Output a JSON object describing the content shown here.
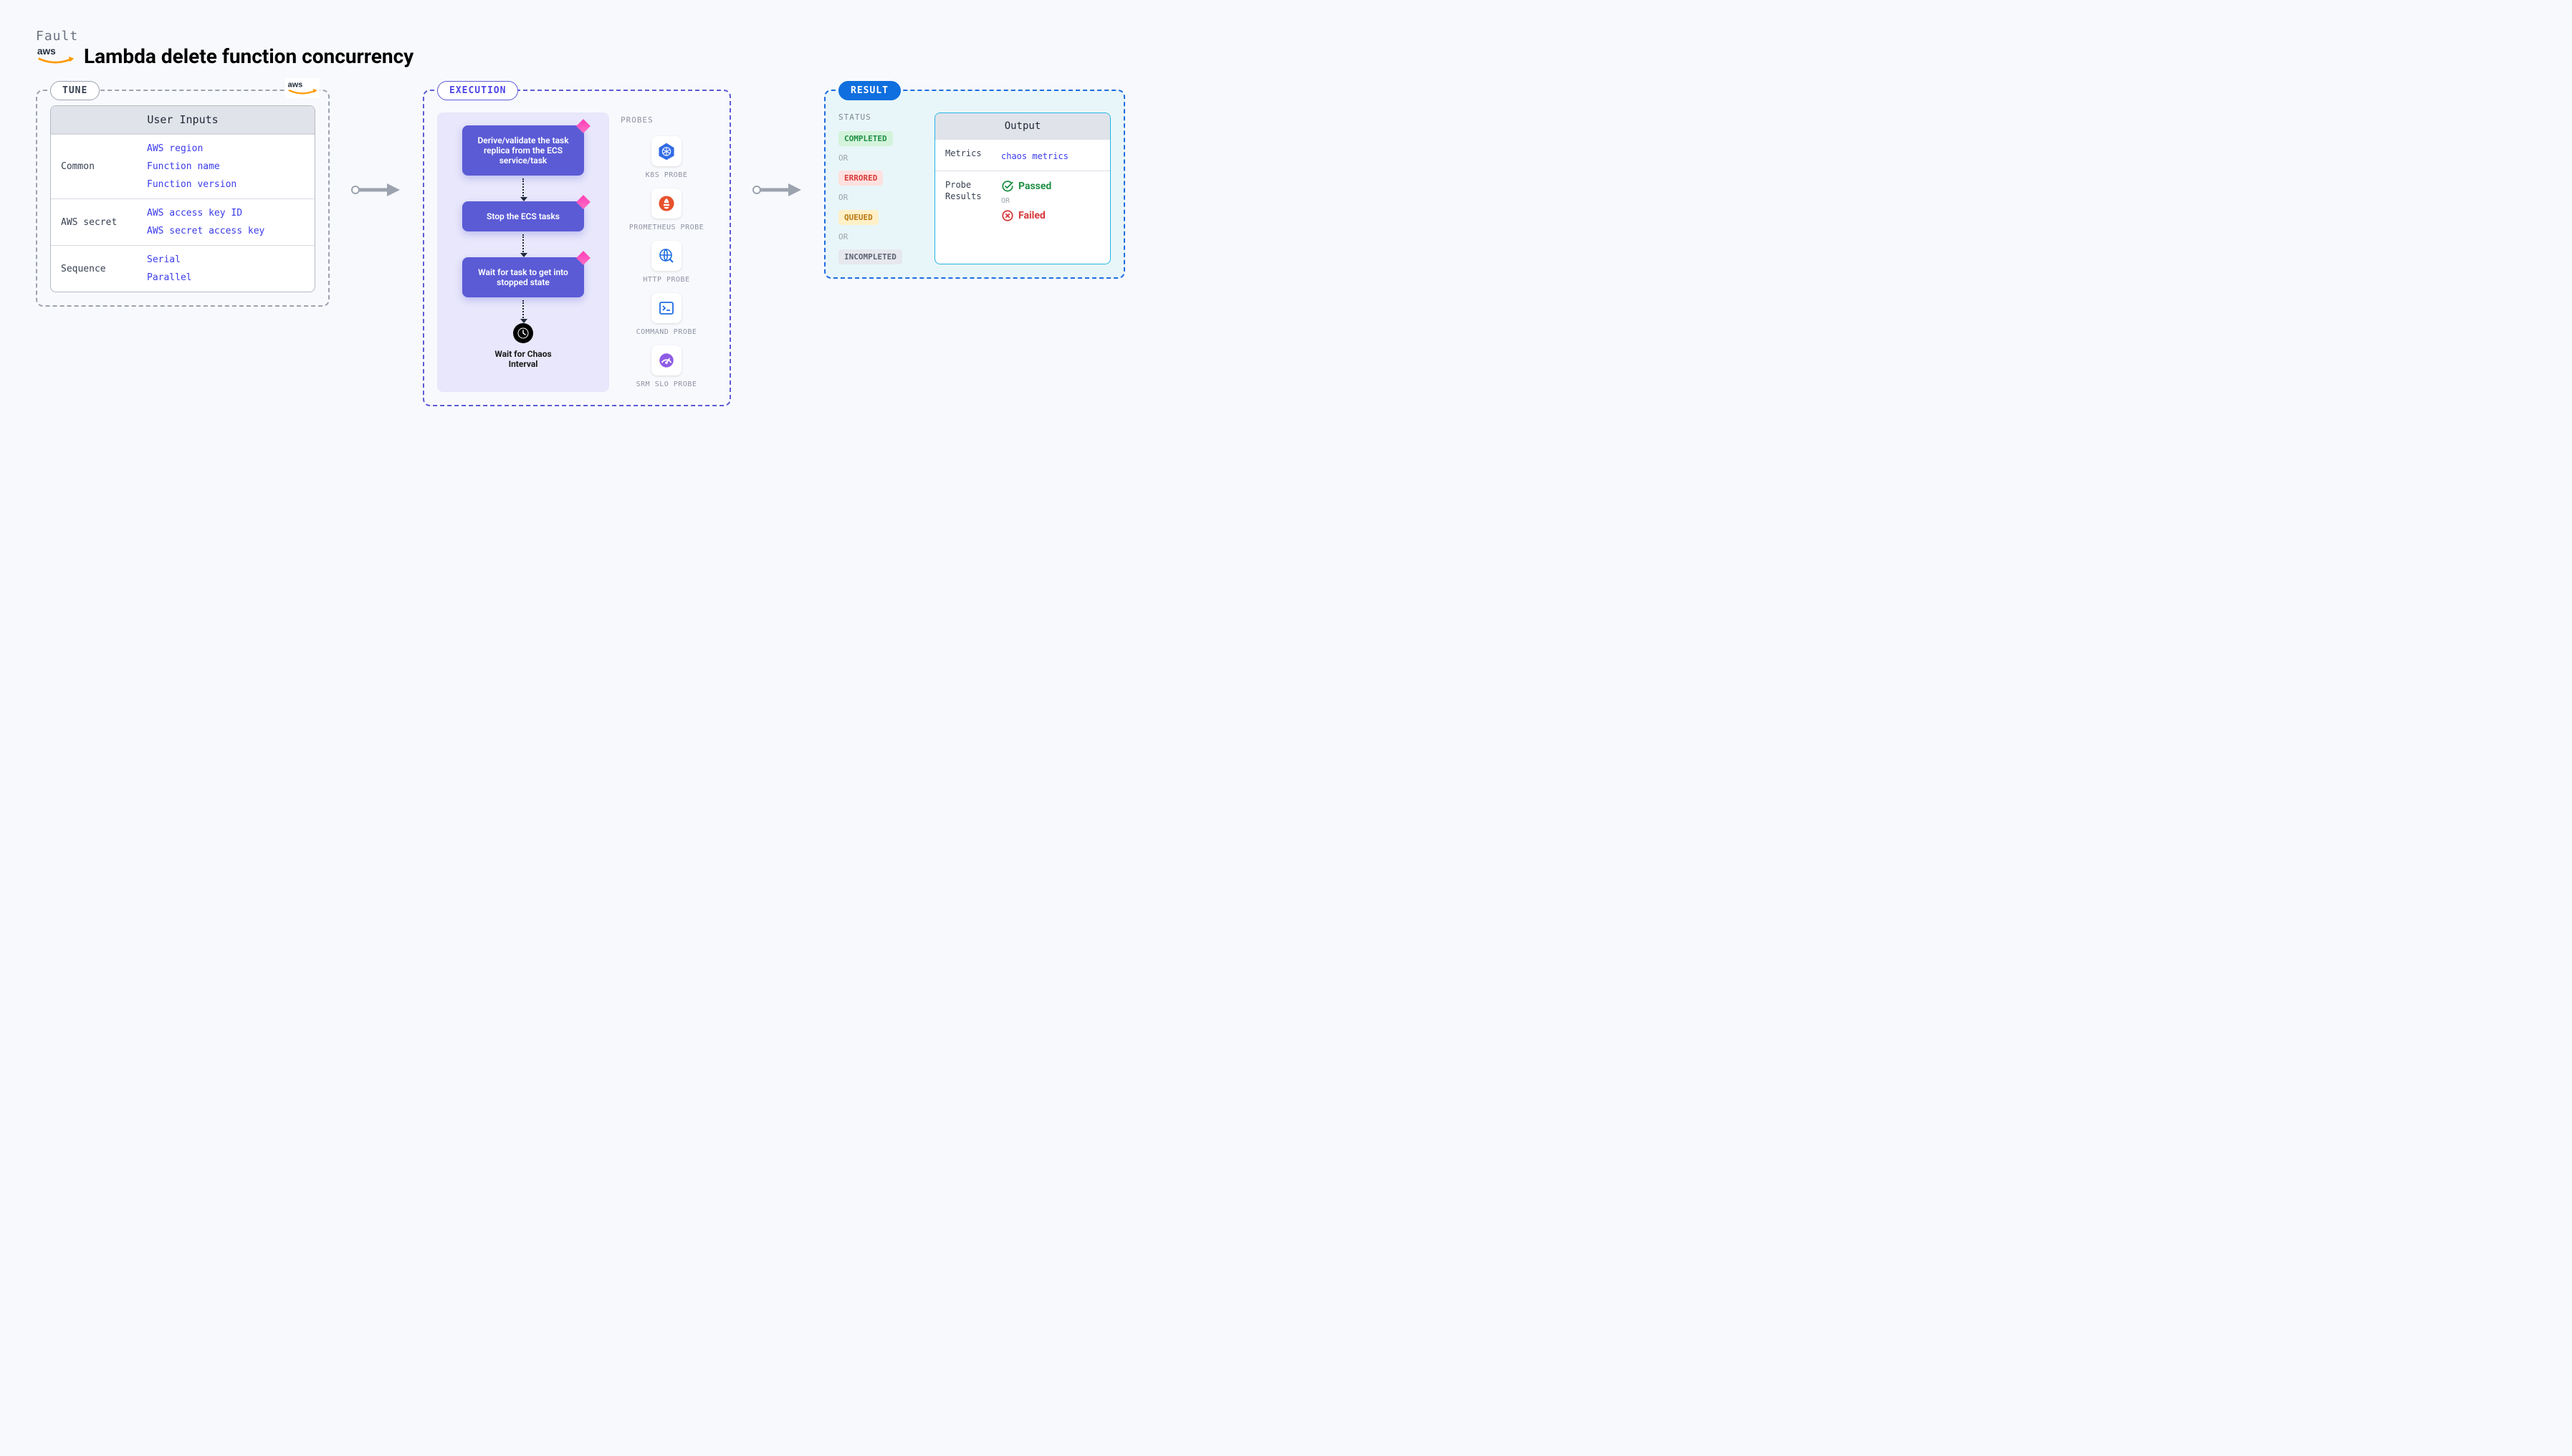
{
  "header": {
    "kicker": "Fault",
    "title": "Lambda delete function concurrency"
  },
  "tune": {
    "tag": "TUNE",
    "card_title": "User Inputs",
    "rows": [
      {
        "label": "Common",
        "values": [
          "AWS region",
          "Function name",
          "Function version"
        ]
      },
      {
        "label": "AWS secret",
        "values": [
          "AWS access key ID",
          "AWS secret access key"
        ]
      },
      {
        "label": "Sequence",
        "values": [
          "Serial",
          "Parallel"
        ]
      }
    ]
  },
  "execution": {
    "tag": "EXECUTION",
    "flow": [
      "Derive/validate the task replica from the ECS service/task",
      "Stop the ECS tasks",
      "Wait for task to get into stopped state"
    ],
    "wait_label": "Wait for Chaos Interval",
    "probes_title": "PROBES",
    "probes": [
      {
        "name": "k8s-probe",
        "label": "K8S PROBE"
      },
      {
        "name": "prometheus-probe",
        "label": "PROMETHEUS PROBE"
      },
      {
        "name": "http-probe",
        "label": "HTTP PROBE"
      },
      {
        "name": "command-probe",
        "label": "COMMAND PROBE"
      },
      {
        "name": "srm-slo-probe",
        "label": "SRM SLO PROBE"
      }
    ]
  },
  "result": {
    "tag": "RESULT",
    "status_title": "STATUS",
    "or": "OR",
    "statuses": [
      {
        "text": "COMPLETED",
        "cls": "completed"
      },
      {
        "text": "ERRORED",
        "cls": "errored"
      },
      {
        "text": "QUEUED",
        "cls": "queued"
      },
      {
        "text": "INCOMPLETED",
        "cls": "incompleted"
      }
    ],
    "output": {
      "title": "Output",
      "metrics_label": "Metrics",
      "metrics_value": "chaos metrics",
      "probe_results_label": "Probe Results",
      "passed": "Passed",
      "failed": "Failed"
    }
  }
}
